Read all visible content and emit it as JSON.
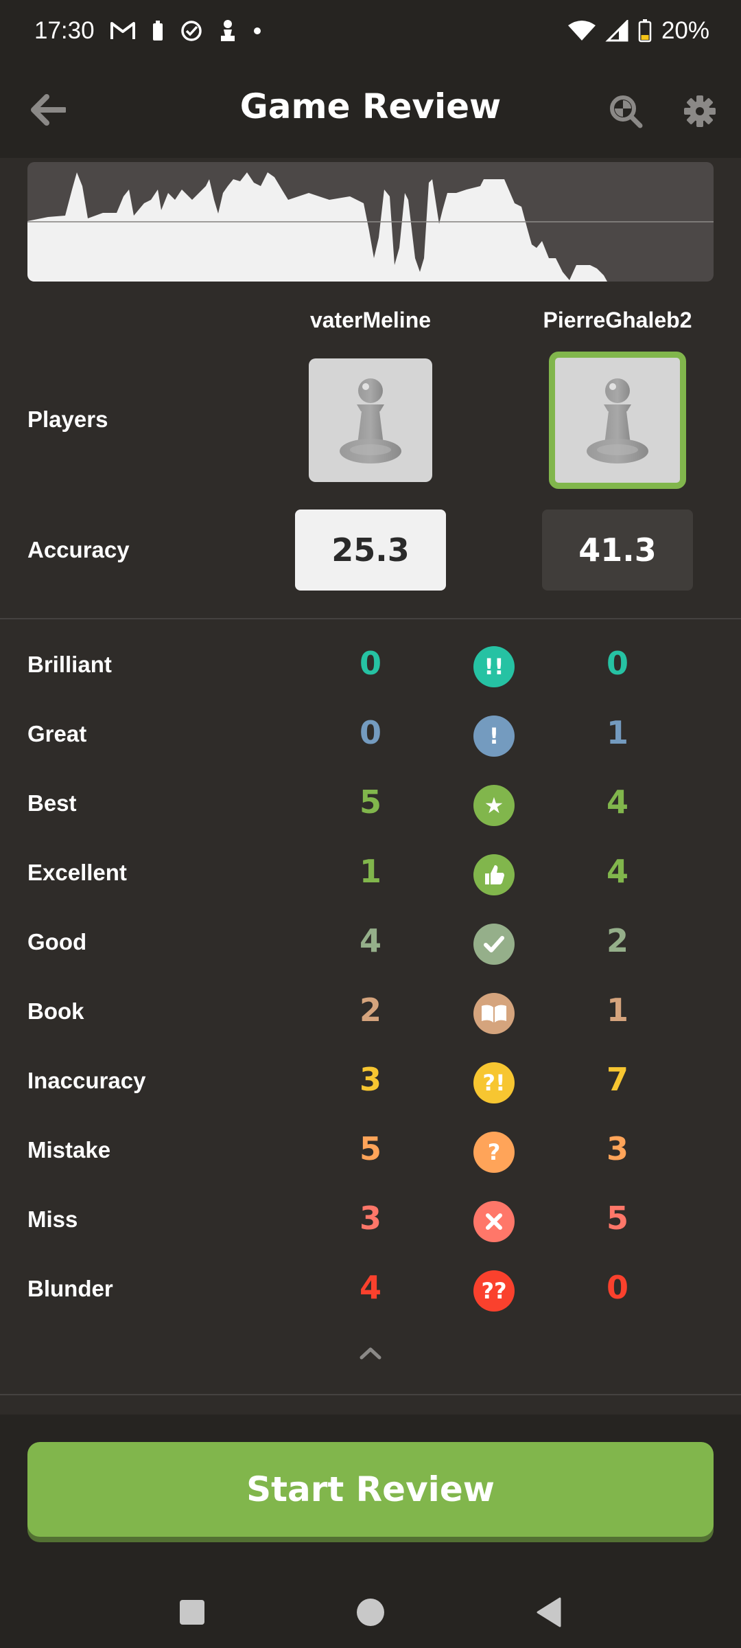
{
  "status_bar": {
    "time": "17:30",
    "battery": "20%",
    "icons": [
      "gmail-icon",
      "battery-saver-icon",
      "check-circle-icon",
      "chess-pawn-icon",
      "dot-icon",
      "wifi-icon",
      "signal-icon",
      "battery-icon"
    ]
  },
  "header": {
    "title": "Game Review"
  },
  "players": {
    "label": "Players",
    "white": {
      "name": "vaterMeline"
    },
    "black": {
      "name": "PierreGhaleb2"
    }
  },
  "accuracy": {
    "label": "Accuracy",
    "white": "25.3",
    "black": "41.3"
  },
  "stats": [
    {
      "label": "Brilliant",
      "white": "0",
      "black": "0",
      "badge": "!!",
      "icon": "brilliant-icon",
      "color": "#26c2a3"
    },
    {
      "label": "Great",
      "white": "0",
      "black": "1",
      "badge": "!",
      "icon": "great-icon",
      "color": "#749bbf"
    },
    {
      "label": "Best",
      "white": "5",
      "black": "4",
      "badge": "★",
      "icon": "best-icon",
      "color": "#81b64c"
    },
    {
      "label": "Excellent",
      "white": "1",
      "black": "4",
      "badge": "👍",
      "icon": "excellent-icon",
      "color": "#81b64c"
    },
    {
      "label": "Good",
      "white": "4",
      "black": "2",
      "badge": "✓",
      "icon": "good-icon",
      "color": "#95af8a"
    },
    {
      "label": "Book",
      "white": "2",
      "black": "1",
      "badge": "📖",
      "icon": "book-icon",
      "color": "#d5a47d"
    },
    {
      "label": "Inaccuracy",
      "white": "3",
      "black": "7",
      "badge": "?!",
      "icon": "inaccuracy-icon",
      "color": "#f7c631"
    },
    {
      "label": "Mistake",
      "white": "5",
      "black": "3",
      "badge": "?",
      "icon": "mistake-icon",
      "color": "#ffa459"
    },
    {
      "label": "Miss",
      "white": "3",
      "black": "5",
      "badge": "✕",
      "icon": "miss-icon",
      "color": "#ff7769"
    },
    {
      "label": "Blunder",
      "white": "4",
      "black": "0",
      "badge": "??",
      "icon": "blunder-icon",
      "color": "#fa412d"
    }
  ],
  "actions": {
    "start_review": "Start Review"
  },
  "colors": {
    "accent_green": "#81b64c",
    "background": "#2f2c29",
    "header_bg": "#262421"
  }
}
